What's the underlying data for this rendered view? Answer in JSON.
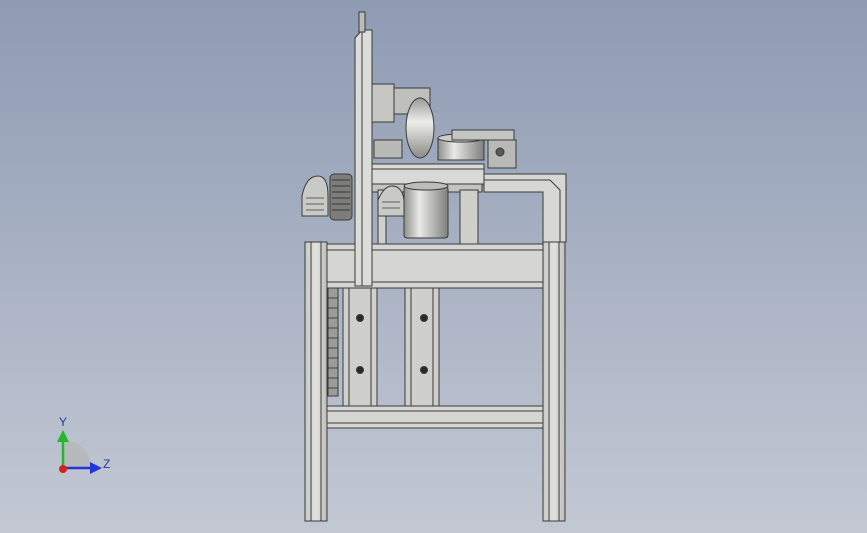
{
  "viewport": {
    "background_top": "#8e9bb2",
    "background_bottom": "#c3c8d3"
  },
  "model": {
    "body_color": "#d3d3cf",
    "shadow_color": "#b4b5b1",
    "edge_color": "#3a3a3a",
    "bolt_color": "#2a2a2a"
  },
  "triad": {
    "y_label": "Y",
    "z_label": "Z",
    "y_color": "#21b82b",
    "z_color": "#1f35d8",
    "origin_color": "#d8201c"
  }
}
